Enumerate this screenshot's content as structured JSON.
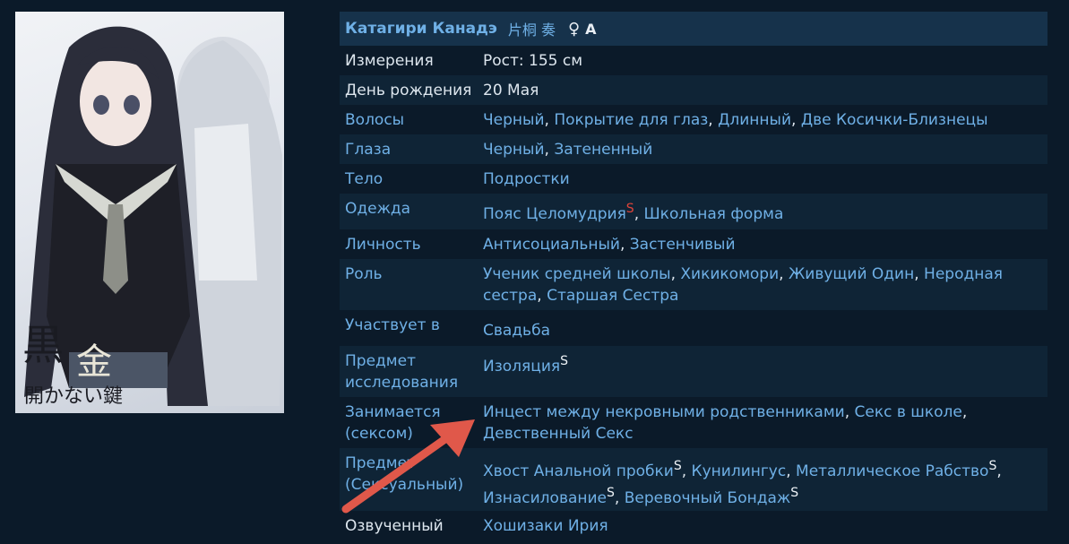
{
  "character": {
    "name": "Катагири Канадэ",
    "name_kanji": "片桐 奏",
    "gender_symbol": "♀",
    "blood_type": "A"
  },
  "cover": {
    "logo_text": "黒と金の開かない鍵"
  },
  "rows": [
    {
      "label": "Измерения",
      "label_link": false,
      "value_plain": "Рост: 155 см"
    },
    {
      "label": "День рождения",
      "label_link": false,
      "value_plain": "20 Мая"
    },
    {
      "label": "Волосы",
      "label_link": true,
      "items": [
        "Черный",
        "Покрытие для глаз",
        "Длинный",
        "Две Косички-Близнецы"
      ]
    },
    {
      "label": "Глаза",
      "label_link": true,
      "items": [
        "Черный",
        "Затененный"
      ]
    },
    {
      "label": "Тело",
      "label_link": true,
      "items": [
        "Подростки"
      ]
    },
    {
      "label": "Одежда",
      "label_link": true,
      "items": [
        "Пояс Целомудрия",
        "Школьная форма"
      ],
      "spoiler_marks": [
        "S"
      ]
    },
    {
      "label": "Личность",
      "label_link": true,
      "items": [
        "Антисоциальный",
        "Застенчивый"
      ]
    },
    {
      "label": "Роль",
      "label_link": true,
      "items": [
        "Ученик средней школы",
        "Хикикомори",
        "Живущий Один",
        "Неродная сестра",
        "Старшая Сестра"
      ]
    },
    {
      "label": "Участвует в",
      "label_link": true,
      "items": [
        "Свадьба"
      ]
    },
    {
      "label": "Предмет исследования",
      "label_link": true,
      "items": [
        "Изоляция"
      ],
      "spoiler_marks": [
        "S"
      ]
    },
    {
      "label": "Занимается (сексом)",
      "label_link": true,
      "items": [
        "Инцест между некровными родственниками",
        "Секс в школе",
        "Девственный Секс"
      ]
    },
    {
      "label": "Предмет (Сексуальный)",
      "label_link": true,
      "items": [
        "Хвост Анальной пробки",
        "Кунилингус",
        "Металлическое Рабство",
        "Изнасилование",
        "Веревочный Бондаж"
      ],
      "spoiler_marks": [
        "S",
        "S",
        "S",
        "S"
      ]
    },
    {
      "label": "Озвученный",
      "label_link": false,
      "items": [
        "Хошизаки Ирия"
      ]
    }
  ],
  "colors": {
    "background": "#0b1a29",
    "row_alt": "#0f2436",
    "header": "#16324b",
    "link": "#6fb0e6",
    "text": "#dde6ee",
    "spoiler_red": "#e0443a",
    "arrow": "#e0584a"
  }
}
